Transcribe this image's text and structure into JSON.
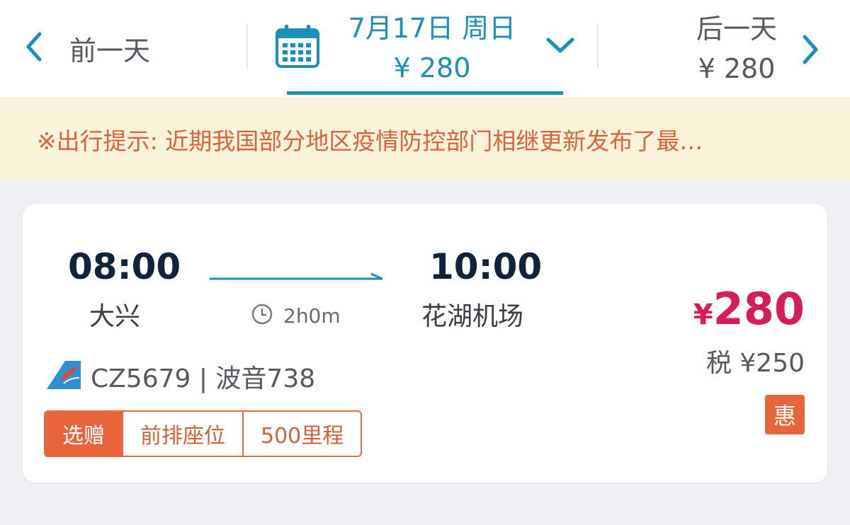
{
  "date_nav": {
    "prev_label": "前一天",
    "current_date": "7月17日 周日",
    "current_price": "¥ 280",
    "next_label": "后一天",
    "next_price": "¥ 280",
    "accent_color": "#1c8fb8",
    "icons": [
      "chevron-left-icon",
      "calendar-icon",
      "chevron-down-icon",
      "chevron-right-icon"
    ]
  },
  "notice": {
    "text": "※出行提示: 近期我国部分地区疫情防控部门相继更新发布了最…"
  },
  "flight": {
    "departure_time": "08:00",
    "departure_airport": "大兴",
    "arrival_time": "10:00",
    "arrival_airport": "花湖机场",
    "duration": "2h0m",
    "flight_no_aircraft": "CZ5679 | 波音738",
    "tags": [
      "选赠",
      "前排座位",
      "500里程"
    ],
    "price_currency": "¥",
    "price_value": "280",
    "tax": "税 ¥250",
    "discount_badge": "惠",
    "price_color": "#d81b5b",
    "tag_color": "#e8653c"
  }
}
